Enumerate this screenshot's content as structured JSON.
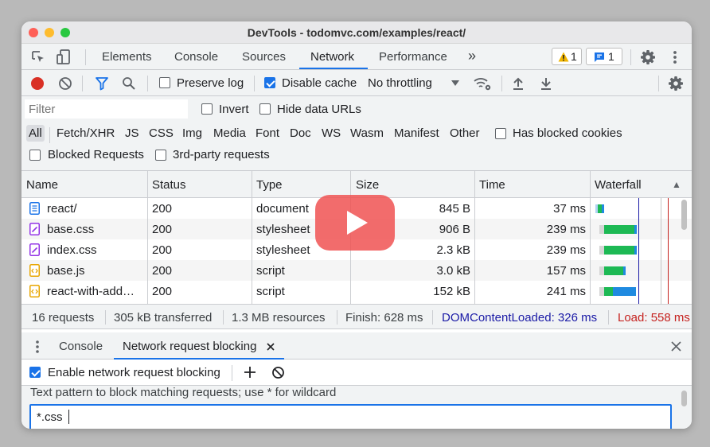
{
  "window": {
    "title": "DevTools - todomvc.com/examples/react/"
  },
  "main_tabs": [
    "Elements",
    "Console",
    "Sources",
    "Network",
    "Performance"
  ],
  "more_tabs_glyph": "»",
  "active_tab": "Network",
  "badges": {
    "warnings": "1",
    "messages": "1"
  },
  "toolbar": {
    "preserve_log": "Preserve log",
    "disable_cache": "Disable cache",
    "throttling": "No throttling",
    "preserve_log_checked": false,
    "disable_cache_checked": true
  },
  "filter": {
    "placeholder": "Filter",
    "invert": "Invert",
    "hide_data_urls": "Hide data URLs"
  },
  "type_filters": [
    "All",
    "Fetch/XHR",
    "JS",
    "CSS",
    "Img",
    "Media",
    "Font",
    "Doc",
    "WS",
    "Wasm",
    "Manifest",
    "Other"
  ],
  "selected_type": "All",
  "has_blocked_cookies": "Has blocked cookies",
  "blocked_requests": "Blocked Requests",
  "third_party": "3rd-party requests",
  "table": {
    "headers": [
      "Name",
      "Status",
      "Type",
      "Size",
      "Time",
      "Waterfall"
    ],
    "sort_glyph": "▲",
    "rows": [
      {
        "name": "react/",
        "status": "200",
        "type": "document",
        "size": "845 B",
        "time": "37 ms",
        "kind": "doc"
      },
      {
        "name": "base.css",
        "status": "200",
        "type": "stylesheet",
        "size": "906 B",
        "time": "239 ms",
        "kind": "css"
      },
      {
        "name": "index.css",
        "status": "200",
        "type": "stylesheet",
        "size": "2.3 kB",
        "time": "239 ms",
        "kind": "css"
      },
      {
        "name": "base.js",
        "status": "200",
        "type": "script",
        "size": "3.0 kB",
        "time": "157 ms",
        "kind": "js"
      },
      {
        "name": "react-with-add…",
        "status": "200",
        "type": "script",
        "size": "152 kB",
        "time": "241 ms",
        "kind": "js"
      }
    ]
  },
  "summary": {
    "requests": "16 requests",
    "transferred": "305 kB transferred",
    "resources": "1.3 MB resources",
    "finish": "Finish: 628 ms",
    "dcl": "DOMContentLoaded: 326 ms",
    "load": "Load: 558 ms"
  },
  "drawer": {
    "tabs": [
      "Console",
      "Network request blocking"
    ],
    "active": "Network request blocking",
    "enable_label": "Enable network request blocking",
    "enable_checked": true,
    "hint": "Text pattern to block matching requests; use * for wildcard",
    "pattern_value": "*.css"
  },
  "colors": {
    "accent": "#1a73e8",
    "dcl": "#1a1aa6",
    "load": "#c5221f",
    "waterfall_green": "#1db954",
    "waterfall_blue": "#1f8ae0",
    "play_button": "#f05252"
  }
}
